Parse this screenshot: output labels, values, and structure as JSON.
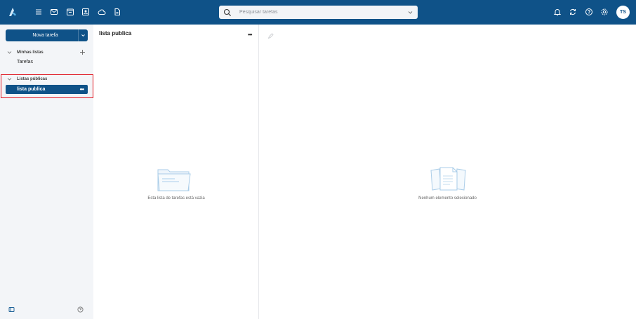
{
  "topbar": {
    "nav_icons": [
      "menu-icon",
      "mail-icon",
      "calendar-icon",
      "contacts-icon",
      "cloud-icon",
      "document-icon"
    ],
    "search_placeholder": "Pesquisar tarefas",
    "right_icons": [
      "bell-icon",
      "refresh-icon",
      "help-icon",
      "gear-icon"
    ],
    "avatar_initials": "TS"
  },
  "sidebar": {
    "new_task_label": "Nova tarefa",
    "my_lists_header": "Minhas listas",
    "my_lists": [
      {
        "label": "Tarefas"
      }
    ],
    "public_lists_header": "Listas públicas",
    "public_lists": [
      {
        "label": "lista publica",
        "active": true
      }
    ]
  },
  "list_pane": {
    "title": "lista publica",
    "empty_text": "Esta lista de tarefas está vazia"
  },
  "detail_pane": {
    "empty_text": "Nenhum elemento selecionado"
  },
  "colors": {
    "brand": "#0f5288",
    "highlight": "#e0141e",
    "sidebar_bg": "#f3f5f8"
  }
}
